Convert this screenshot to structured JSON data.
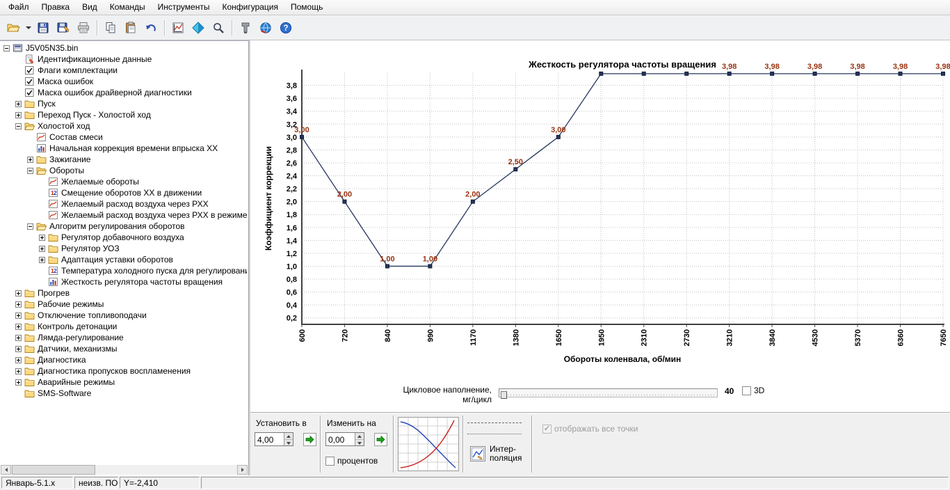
{
  "menu": {
    "items": [
      {
        "name": "file",
        "label": "Файл"
      },
      {
        "name": "edit",
        "label": "Правка"
      },
      {
        "name": "view",
        "label": "Вид"
      },
      {
        "name": "commands",
        "label": "Команды"
      },
      {
        "name": "tools",
        "label": "Инструменты"
      },
      {
        "name": "configuration",
        "label": "Конфигурация"
      },
      {
        "name": "help",
        "label": "Помощь"
      }
    ]
  },
  "toolbar": {
    "buttons": [
      {
        "name": "open-button",
        "icon": "open-icon"
      },
      {
        "name": "open-menu-button",
        "icon": "chevron-down-icon",
        "narrow": true
      },
      {
        "name": "save-button",
        "icon": "save-icon"
      },
      {
        "name": "save-as-button",
        "icon": "save-as-icon"
      },
      {
        "name": "print-button",
        "icon": "print-icon"
      },
      {
        "sep": true
      },
      {
        "name": "copy-button",
        "icon": "copy-icon"
      },
      {
        "name": "paste-button",
        "icon": "paste-icon"
      },
      {
        "name": "undo-button",
        "icon": "undo-icon"
      },
      {
        "sep": true
      },
      {
        "name": "chart-view-button",
        "icon": "chart-icon"
      },
      {
        "name": "compare-button",
        "icon": "diamond-icon"
      },
      {
        "name": "zoom-button",
        "icon": "magnifier-icon"
      },
      {
        "sep": true
      },
      {
        "name": "tools-button",
        "icon": "clamp-icon"
      },
      {
        "name": "connection-button",
        "icon": "network-icon"
      },
      {
        "name": "help-button",
        "icon": "help-icon"
      }
    ]
  },
  "tree": {
    "items": [
      {
        "level": 0,
        "toggle": "-",
        "icon": "bin",
        "label": "J5V05N35.bin"
      },
      {
        "level": 1,
        "icon": "doc",
        "label": "Идентификационные данные"
      },
      {
        "level": 1,
        "icon": "check",
        "label": "Флаги комплектации"
      },
      {
        "level": 1,
        "icon": "check",
        "label": "Маска ошибок"
      },
      {
        "level": 1,
        "icon": "check",
        "label": "Маска ошибок драйверной диагностики"
      },
      {
        "level": 1,
        "toggle": "+",
        "icon": "folder",
        "label": "Пуск"
      },
      {
        "level": 1,
        "toggle": "+",
        "icon": "folder",
        "label": "Переход Пуск - Холостой ход"
      },
      {
        "level": 1,
        "toggle": "-",
        "icon": "folder-open",
        "label": "Холостой ход"
      },
      {
        "level": 2,
        "icon": "map",
        "label": "Состав смеси"
      },
      {
        "level": 2,
        "icon": "barchart",
        "label": "Начальная коррекция времени впрыска ХХ"
      },
      {
        "level": 2,
        "toggle": "+",
        "icon": "folder",
        "label": "Зажигание"
      },
      {
        "level": 2,
        "toggle": "-",
        "icon": "folder-open",
        "label": "Обороты"
      },
      {
        "level": 3,
        "icon": "map",
        "label": "Желаемые обороты"
      },
      {
        "level": 3,
        "icon": "num",
        "label": "Смещение оборотов ХХ в движении"
      },
      {
        "level": 3,
        "icon": "map",
        "label": "Желаемый расход воздуха через РХХ"
      },
      {
        "level": 3,
        "icon": "map",
        "label": "Желаемый расход воздуха через РХХ в режиме п"
      },
      {
        "level": 2,
        "toggle": "-",
        "icon": "folder-open",
        "label": "Алгоритм регулирования оборотов"
      },
      {
        "level": 3,
        "toggle": "+",
        "icon": "folder",
        "label": "Регулятор добавочного воздуха"
      },
      {
        "level": 3,
        "toggle": "+",
        "icon": "folder",
        "label": "Регулятор УОЗ"
      },
      {
        "level": 3,
        "toggle": "+",
        "icon": "folder",
        "label": "Адаптация уставки оборотов"
      },
      {
        "level": 3,
        "icon": "num",
        "label": "Температура холодного пуска для регулирования"
      },
      {
        "level": 3,
        "icon": "barchart",
        "label": "Жесткость регулятора частоты вращения"
      },
      {
        "level": 1,
        "toggle": "+",
        "icon": "folder",
        "label": "Прогрев"
      },
      {
        "level": 1,
        "toggle": "+",
        "icon": "folder",
        "label": "Рабочие режимы"
      },
      {
        "level": 1,
        "toggle": "+",
        "icon": "folder",
        "label": "Отключение топливоподачи"
      },
      {
        "level": 1,
        "toggle": "+",
        "icon": "folder",
        "label": "Контроль детонации"
      },
      {
        "level": 1,
        "toggle": "+",
        "icon": "folder",
        "label": "Лямда-регулирование"
      },
      {
        "level": 1,
        "toggle": "+",
        "icon": "folder",
        "label": "Датчики, механизмы"
      },
      {
        "level": 1,
        "toggle": "+",
        "icon": "folder",
        "label": "Диагностика"
      },
      {
        "level": 1,
        "toggle": "+",
        "icon": "folder",
        "label": "Диагностика пропусков воспламенения"
      },
      {
        "level": 1,
        "toggle": "+",
        "icon": "folder",
        "label": "Аварийные режимы"
      },
      {
        "level": 1,
        "icon": "folder",
        "label": "SMS-Software"
      }
    ]
  },
  "chart_data": {
    "type": "line",
    "title": "Жесткость регулятора частоты вращения",
    "xlabel": "Обороты коленвала, об/мин",
    "ylabel": "Коэффициент коррекции",
    "categories": [
      600,
      720,
      840,
      990,
      1170,
      1380,
      1650,
      1950,
      2310,
      2730,
      3210,
      3840,
      4530,
      5370,
      6360,
      7650
    ],
    "values": [
      3.0,
      2.0,
      1.0,
      1.0,
      2.0,
      2.5,
      3.0,
      3.98,
      3.98,
      3.98,
      3.98,
      3.98,
      3.98,
      3.98,
      3.98,
      3.98
    ],
    "ylim": [
      0.1,
      4.0
    ],
    "ytick_range": [
      0.2,
      3.8
    ],
    "ytick_step": 0.2,
    "grid": true,
    "legend": false,
    "line_color": "#25355e",
    "marker_color": "#25355e",
    "label_color": "#993311"
  },
  "cycle": {
    "label1": "Цикловое наполнение,",
    "label2": "мг/цикл",
    "value": "40",
    "checkbox_3d": "3D"
  },
  "panel": {
    "set_group": {
      "title": "Установить в",
      "value": "4,00"
    },
    "change_group": {
      "title": "Изменить на",
      "value": "0,00",
      "checkbox": "процентов"
    },
    "interpolation": {
      "label1": "Интер-",
      "label2": "поляция"
    },
    "show_all_points": "отображать все точки"
  },
  "statusbar": {
    "cells": [
      "Январь-5.1.x",
      "неизв. ПО",
      "Y=-2,410"
    ]
  },
  "colors": {
    "accent_green": "#1fa01f",
    "grid": "#c0c0c0",
    "axis": "#404040"
  }
}
